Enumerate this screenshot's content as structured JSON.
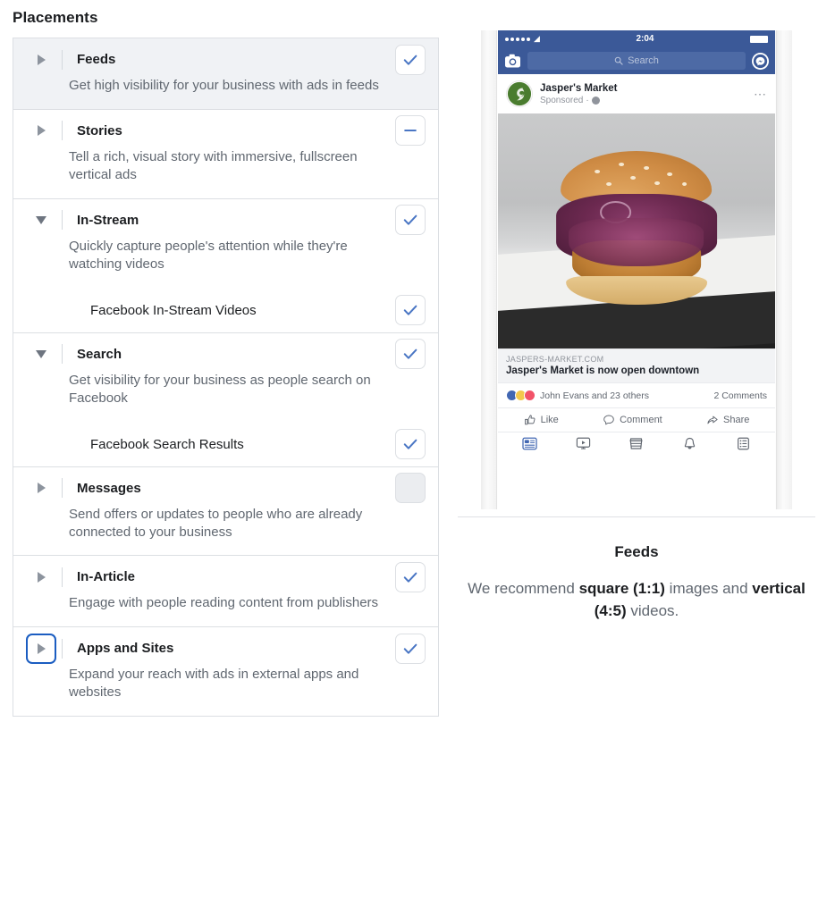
{
  "page_title": "Placements",
  "colors": {
    "accent_blue": "#4267b2",
    "check_blue": "#4a76c4",
    "focus_ring": "#1b5dc1",
    "fb_navy": "#3b5998",
    "selected_row_bg": "#f0f2f5"
  },
  "placements": [
    {
      "name": "Feeds",
      "description": "Get high visibility for your business with ads in feeds",
      "expanded": false,
      "selected": true,
      "checkbox": "checked",
      "focused": false,
      "children": []
    },
    {
      "name": "Stories",
      "description": "Tell a rich, visual story with immersive, fullscreen vertical ads",
      "expanded": false,
      "selected": false,
      "checkbox": "partial",
      "focused": false,
      "children": []
    },
    {
      "name": "In-Stream",
      "description": "Quickly capture people's attention while they're watching videos",
      "expanded": true,
      "selected": false,
      "checkbox": "checked",
      "focused": false,
      "children": [
        {
          "name": "Facebook In-Stream Videos",
          "checkbox": "checked"
        }
      ]
    },
    {
      "name": "Search",
      "description": "Get visibility for your business as people search on Facebook",
      "expanded": true,
      "selected": false,
      "checkbox": "checked",
      "focused": false,
      "children": [
        {
          "name": "Facebook Search Results",
          "checkbox": "checked"
        }
      ]
    },
    {
      "name": "Messages",
      "description": "Send offers or updates to people who are already connected to your business",
      "expanded": false,
      "selected": false,
      "checkbox": "unchecked",
      "focused": false,
      "children": []
    },
    {
      "name": "In-Article",
      "description": "Engage with people reading content from publishers",
      "expanded": false,
      "selected": false,
      "checkbox": "checked",
      "focused": false,
      "children": []
    },
    {
      "name": "Apps and Sites",
      "description": "Expand your reach with ads in external apps and websites",
      "expanded": false,
      "selected": false,
      "checkbox": "checked",
      "focused": true,
      "children": []
    }
  ],
  "preview": {
    "phone": {
      "status_bar": {
        "time": "2:04",
        "signal_dots": 5
      },
      "nav": {
        "camera_icon": "camera-icon",
        "search_placeholder": "Search",
        "messenger_icon": "messenger-icon"
      },
      "post": {
        "page_name": "Jasper's Market",
        "sponsored_label": "Sponsored",
        "privacy_icon": "globe-icon",
        "more_icon": "ellipsis-icon",
        "image_alt": "fried chicken burger with purple slaw on a white plate",
        "link_domain": "JASPERS-MARKET.COM",
        "link_title": "Jasper's Market is now open downtown",
        "reactions_text": "John Evans and 23 others",
        "comments_text": "2 Comments",
        "actions": [
          {
            "label": "Like",
            "icon": "thumbs-up-icon"
          },
          {
            "label": "Comment",
            "icon": "comment-bubble-icon"
          },
          {
            "label": "Share",
            "icon": "share-arrow-icon"
          }
        ]
      },
      "tabbar": [
        {
          "icon": "news-feed-icon",
          "active": true
        },
        {
          "icon": "watch-video-icon",
          "active": false
        },
        {
          "icon": "marketplace-icon",
          "active": false
        },
        {
          "icon": "notifications-bell-icon",
          "active": false
        },
        {
          "icon": "menu-list-icon",
          "active": false
        }
      ]
    },
    "caption_title": "Feeds",
    "caption_parts": [
      {
        "text": "We recommend ",
        "bold": false
      },
      {
        "text": "square (1:1)",
        "bold": true
      },
      {
        "text": " images and ",
        "bold": false
      },
      {
        "text": "vertical (4:5)",
        "bold": true
      },
      {
        "text": " videos.",
        "bold": false
      }
    ]
  }
}
